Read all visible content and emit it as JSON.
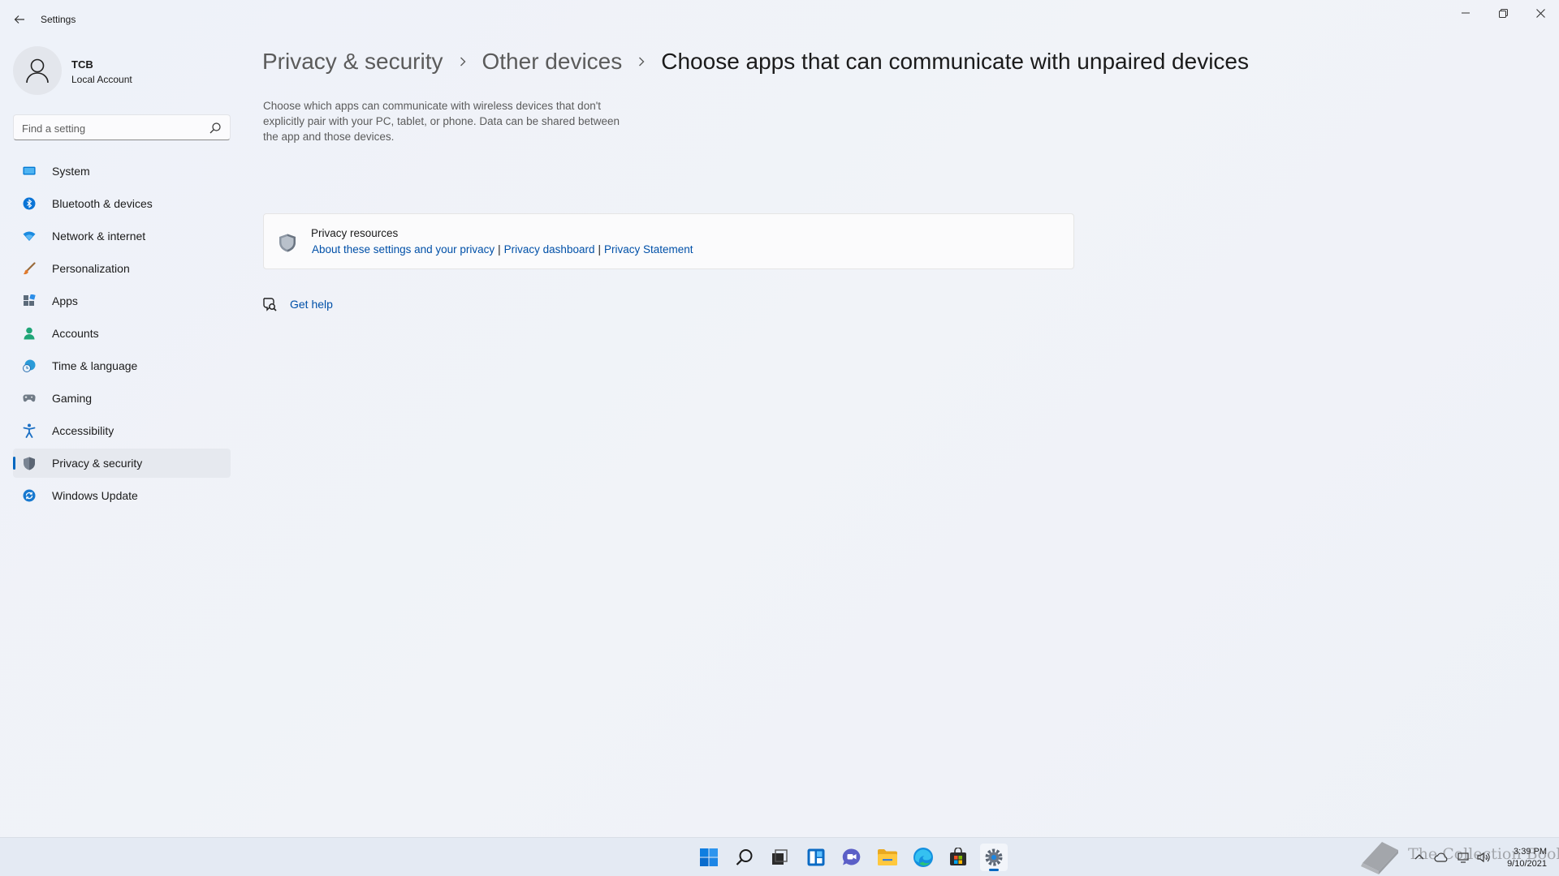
{
  "window": {
    "title": "Settings"
  },
  "profile": {
    "name": "TCB",
    "account_type": "Local Account"
  },
  "search": {
    "placeholder": "Find a setting"
  },
  "sidebar": {
    "items": [
      {
        "label": "System",
        "icon": "system-icon",
        "active": false
      },
      {
        "label": "Bluetooth & devices",
        "icon": "bluetooth-icon",
        "active": false
      },
      {
        "label": "Network & internet",
        "icon": "wifi-icon",
        "active": false
      },
      {
        "label": "Personalization",
        "icon": "brush-icon",
        "active": false
      },
      {
        "label": "Apps",
        "icon": "apps-icon",
        "active": false
      },
      {
        "label": "Accounts",
        "icon": "person-icon",
        "active": false
      },
      {
        "label": "Time & language",
        "icon": "globe-clock-icon",
        "active": false
      },
      {
        "label": "Gaming",
        "icon": "gamepad-icon",
        "active": false
      },
      {
        "label": "Accessibility",
        "icon": "accessibility-icon",
        "active": false
      },
      {
        "label": "Privacy & security",
        "icon": "shield-icon",
        "active": true
      },
      {
        "label": "Windows Update",
        "icon": "update-icon",
        "active": false
      }
    ]
  },
  "breadcrumb": {
    "level1": "Privacy & security",
    "level2": "Other devices",
    "current": "Choose apps that can communicate with unpaired devices"
  },
  "main": {
    "description": "Choose which apps can communicate with wireless devices that don't explicitly pair with your PC, tablet, or phone. Data can be shared between the app and those devices.",
    "resources": {
      "title": "Privacy resources",
      "links": [
        "About these settings and your privacy",
        "Privacy dashboard",
        "Privacy Statement"
      ]
    },
    "help_label": "Get help"
  },
  "taskbar": {
    "apps": [
      "start-icon",
      "search-icon",
      "task-view-icon",
      "widgets-icon",
      "chat-icon",
      "file-explorer-icon",
      "edge-icon",
      "store-icon",
      "settings-icon"
    ],
    "active_app": "settings-icon",
    "time": "3:39 PM",
    "date": "9/10/2021"
  },
  "watermark": {
    "text": "The Collection Book"
  },
  "colors": {
    "accent": "#0067c0",
    "link": "#0050a8",
    "background": "#eef2f8"
  }
}
